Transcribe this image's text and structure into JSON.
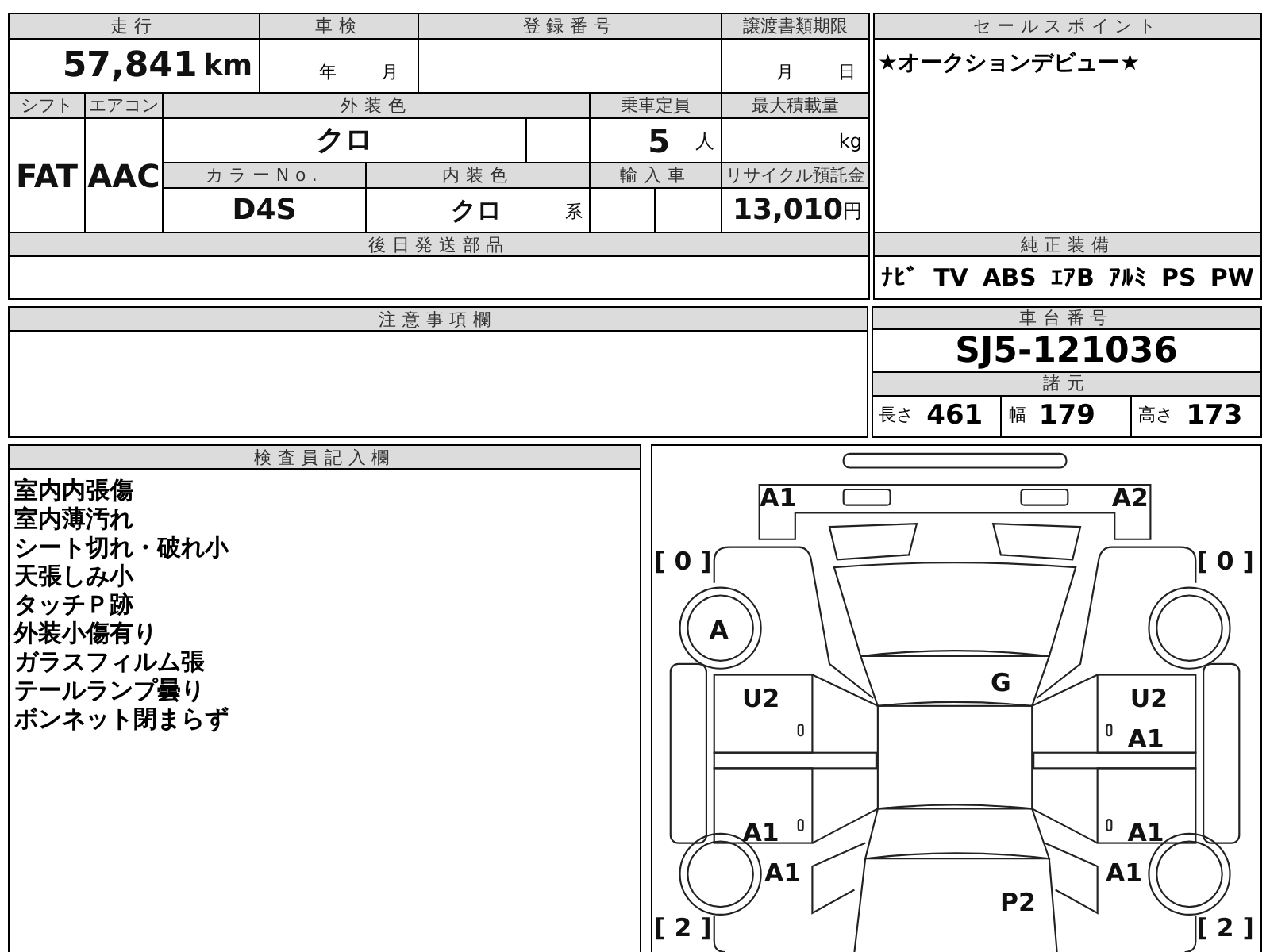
{
  "top_table": {
    "mileage": {
      "label": "走行",
      "value": "57,841",
      "unit": "km"
    },
    "inspection": {
      "label": "車検",
      "year_unit": "年",
      "month_unit": "月"
    },
    "registration": {
      "label": "登録番号"
    },
    "transfer_deadline": {
      "label": "譲渡書類期限",
      "month_unit": "月",
      "day_unit": "日"
    },
    "shift": {
      "label": "シフト",
      "value": "FAT"
    },
    "aircon": {
      "label": "エアコン",
      "value": "AAC"
    },
    "exterior_color": {
      "label": "外装色",
      "value": "クロ"
    },
    "capacity": {
      "label": "乗車定員",
      "value": "5",
      "unit": "人"
    },
    "max_load": {
      "label": "最大積載量",
      "unit": "kg"
    },
    "color_no": {
      "label": "カラーNo.",
      "value": "D4S"
    },
    "interior_color": {
      "label": "内装色",
      "value": "クロ",
      "unit": "系"
    },
    "imported": {
      "label": "輸入車"
    },
    "recycle_fee": {
      "label": "リサイクル預託金",
      "value": "13,010",
      "unit": "円"
    },
    "later_parts": {
      "label": "後日発送部品"
    }
  },
  "sales_point": {
    "label": "セールスポイント",
    "text": "★オークションデビュー★"
  },
  "equipment": {
    "label": "純正装備",
    "items": [
      "ﾅﾋﾞ",
      "TV",
      "ABS",
      "ｴｱB",
      "ｱﾙﾐ",
      "PS",
      "PW"
    ]
  },
  "notes": {
    "label": "注意事項欄"
  },
  "chassis": {
    "label": "車台番号",
    "value": "SJ5-121036"
  },
  "specs": {
    "label": "諸元",
    "items": [
      {
        "label": "長さ",
        "value": "461"
      },
      {
        "label": "幅",
        "value": "179"
      },
      {
        "label": "高さ",
        "value": "173"
      }
    ]
  },
  "inspector": {
    "label": "検査員記入欄",
    "lines": [
      "室内内張傷",
      "室内薄汚れ",
      "シート切れ・破れ小",
      "天張しみ小",
      "タッチＰ跡",
      "外装小傷有り",
      "ガラスフィルム張",
      "テールランプ曇り",
      "ボンネット閉まらず"
    ]
  },
  "diagram": {
    "marks": {
      "front_bumper_left": "A1",
      "front_bumper_right": "A2",
      "front_left_bracket": "[ 0 ]",
      "front_right_bracket": "[ 0 ]",
      "front_left_tire": "A",
      "windshield": "G",
      "front_left_door": "U2",
      "front_right_door": "U2",
      "front_right_door_lower": "A1",
      "rear_left_door": "A1",
      "rear_right_door": "A1",
      "rear_left_fender": "A1",
      "rear_right_fender": "A1",
      "rear": "P2",
      "rear_left_bracket": "[ 2 ]",
      "rear_right_bracket": "[ 2 ]"
    }
  }
}
